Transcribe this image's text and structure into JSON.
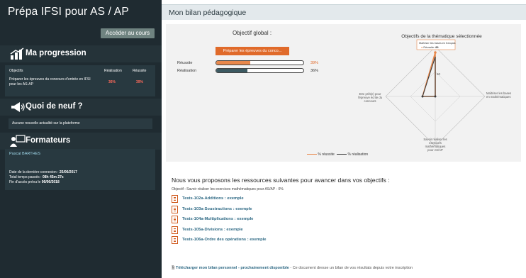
{
  "sidebar": {
    "title": "Prépa IFSI pour AS / AP",
    "access_button": "Accéder au cours",
    "progression": {
      "heading": "Ma progression",
      "columns": [
        "Objectifs",
        "Réalisation",
        "Réussite"
      ],
      "rows": [
        {
          "objective": "Préparer les épreuves du concours d'entrée en IFSI pour les AS-AP",
          "realisation": "36%",
          "reussite": "39%"
        }
      ]
    },
    "news": {
      "heading": "Quoi de neuf ?",
      "message": "Aucune nouvelle actualité sur la plateforme"
    },
    "trainers": {
      "heading": "Formateurs",
      "name": "Pascal BARTHES",
      "last_login_label": "Date de la dernière connexion :",
      "last_login_value": "25/06/2017",
      "time_label": "Total temps passés :",
      "time_value": "08h 45m 27s",
      "end_label": "Fin d'accès prévu le",
      "end_value": "06/06/2018"
    }
  },
  "main": {
    "header_title": "Mon bilan pédagogique",
    "global": {
      "title": "Objectif global :",
      "objective_button": "Préparer les épreuves du conco...",
      "reussite_label": "Réussite",
      "reussite_value": 0.39,
      "reussite_text": "39%",
      "realisation_label": "Réalisation",
      "realisation_value": 0.36,
      "realisation_text": "36%"
    },
    "radar": {
      "title": "Objectifs de la thématique sélectionnée",
      "axes": [
        "Maîtriser les bases en français",
        "Maîtriser les bases en mathématiques",
        "Savoir réaliser les exercices mathématiques pour AS/AP",
        "Etre prêt(e) pour l'épreuve écrite du concours"
      ],
      "tooltip_title": "Maîtriser les bases en français",
      "tooltip_series": "Réussite:",
      "tooltip_value": "89",
      "tick_label": "50",
      "legend_reussite": "% réussite",
      "legend_realisation": "% réalisation",
      "color_reussite": "#e8884c",
      "color_realisation": "#3a3a3a"
    },
    "recommend": {
      "title": "Nous vous proposons les ressources suivantes pour avancer dans vos objectifs :",
      "subtitle": "Objectif : Savoir réaliser les exercices mathématiques pour AS/AP - 0%",
      "items": [
        "Tests-102a-Additions : exemple",
        "Tests-103a-Soustractions : exemple",
        "Tests-104a-Multiplications : exemple",
        "Tests-105a-Divisions : exemple",
        "Tests-106a-Ordre des opérations : exemple"
      ]
    },
    "download": {
      "link": "Télécharger mon bilan personnel - prochainement disponible",
      "desc": "- Ce document dresse un bilan de vos résultats depuis votre inscription"
    }
  },
  "colors": {
    "accent": "#e06a2a",
    "sidebar": "#1f2b31",
    "link": "#2f6a85"
  }
}
